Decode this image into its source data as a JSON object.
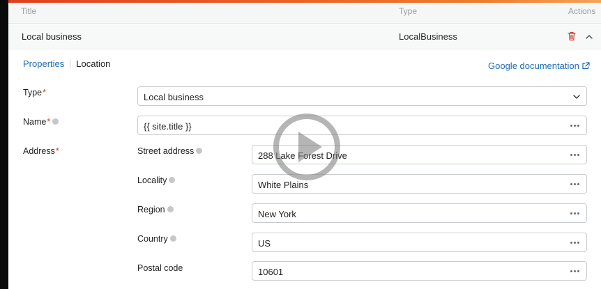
{
  "table_header": {
    "title": "Title",
    "type": "Type",
    "actions": "Actions"
  },
  "item": {
    "title": "Local business",
    "type": "LocalBusiness"
  },
  "tabs": [
    {
      "label": "Properties"
    },
    {
      "label": "Location"
    }
  ],
  "doc_link": "Google documentation",
  "form": {
    "type": {
      "label": "Type",
      "required": "*",
      "value": "Local business"
    },
    "name": {
      "label": "Name",
      "required": "*",
      "value": "{{ site.title }}"
    },
    "address": {
      "label": "Address",
      "required": "*",
      "street": {
        "label": "Street address",
        "value": "288 Lake Forest Drive"
      },
      "locality": {
        "label": "Locality",
        "value": "White Plains"
      },
      "region": {
        "label": "Region",
        "value": "New York"
      },
      "country": {
        "label": "Country",
        "value": "US"
      },
      "postal": {
        "label": "Postal code",
        "value": "10601"
      }
    }
  },
  "colors": {
    "accent": "#1c6ab2",
    "required": "#d13b2b",
    "delete": "#d13b2b",
    "top_bar": "#e0401e"
  },
  "icons": {
    "delete": "trash-icon",
    "collapse": "chevron-up-icon",
    "external": "external-link-icon",
    "more": "more-dots-icon",
    "help": "help-icon",
    "overlay": "play-icon"
  }
}
